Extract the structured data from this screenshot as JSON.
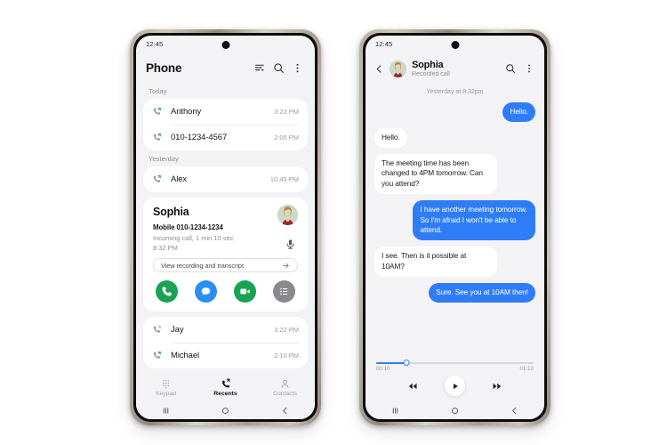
{
  "left_phone": {
    "status": {
      "time": "12:45"
    },
    "header": {
      "title": "Phone",
      "icons": [
        "sort-icon",
        "search-icon",
        "overflow-menu-icon"
      ]
    },
    "groups": [
      {
        "label": "Today",
        "calls": [
          {
            "icon": "outgoing-call-icon",
            "name": "Anthony",
            "time": "3:22 PM"
          },
          {
            "icon": "outgoing-call-icon",
            "name": "010-1234-4567",
            "time": "2:05 PM"
          }
        ]
      },
      {
        "label": "Yesterday",
        "calls": [
          {
            "icon": "outgoing-call-icon",
            "name": "Alex",
            "time": "10:45 PM"
          }
        ]
      }
    ],
    "expanded_call": {
      "name": "Sophia",
      "number_label": "Mobile 010-1234-1234",
      "detail": "Incoming call, 1 min 10 sec",
      "time": "8:32 PM",
      "recording_button": "View recording and transcript",
      "mic_icon": "microphone-icon",
      "arrow_icon": "arrow-right-icon",
      "actions": [
        {
          "name": "call",
          "icon": "phone-icon",
          "color": "#19a353"
        },
        {
          "name": "message",
          "icon": "message-icon",
          "color": "#2a8ef0"
        },
        {
          "name": "video-call",
          "icon": "video-camera-icon",
          "color": "#19a353"
        },
        {
          "name": "more",
          "icon": "list-icon",
          "color": "#8a8a8e"
        }
      ]
    },
    "more_calls": [
      {
        "icon": "missed-call-icon",
        "name": "Jay",
        "time": "3:22 PM"
      },
      {
        "icon": "outgoing-call-icon",
        "name": "Michael",
        "time": "2:10 PM"
      }
    ],
    "tabs": [
      {
        "label": "Keypad",
        "icon": "keypad-icon",
        "active": false
      },
      {
        "label": "Recents",
        "icon": "recents-icon",
        "active": true
      },
      {
        "label": "Contacts",
        "icon": "contacts-icon",
        "active": false
      }
    ],
    "navbar": [
      "recents-nav-icon",
      "home-nav-icon",
      "back-nav-icon"
    ]
  },
  "right_phone": {
    "status": {
      "time": "12:45"
    },
    "header": {
      "back_icon": "chevron-left-icon",
      "name": "Sophia",
      "subtitle": "Recorded call",
      "icons": [
        "search-icon",
        "overflow-menu-icon"
      ]
    },
    "chat": {
      "date_divider": "Yesterday at 8.32pm",
      "messages": [
        {
          "side": "me",
          "text": "Hello."
        },
        {
          "side": "them",
          "text": "Hello."
        },
        {
          "side": "them",
          "text": "The meeting time has been changed to 4PM tomorrow. Can you attend?"
        },
        {
          "side": "me",
          "text": "I have another meeting tomorrow. So I'm afraid I won't be able to attend."
        },
        {
          "side": "them",
          "text": "I see. Then is it possible at 10AM?"
        },
        {
          "side": "me",
          "text": "Sure. See you at 10AM then!"
        }
      ]
    },
    "player": {
      "elapsed": "00:10",
      "duration": "01:10",
      "progress_percent": 19,
      "controls": [
        {
          "name": "rewind",
          "icon": "rewind-icon"
        },
        {
          "name": "play",
          "icon": "play-icon"
        },
        {
          "name": "forward",
          "icon": "fast-forward-icon"
        }
      ]
    },
    "navbar": [
      "recents-nav-icon",
      "home-nav-icon",
      "back-nav-icon"
    ]
  },
  "colors": {
    "accent_blue": "#2f7df6",
    "green": "#19a353",
    "screen_bg": "#f3f3f5"
  }
}
